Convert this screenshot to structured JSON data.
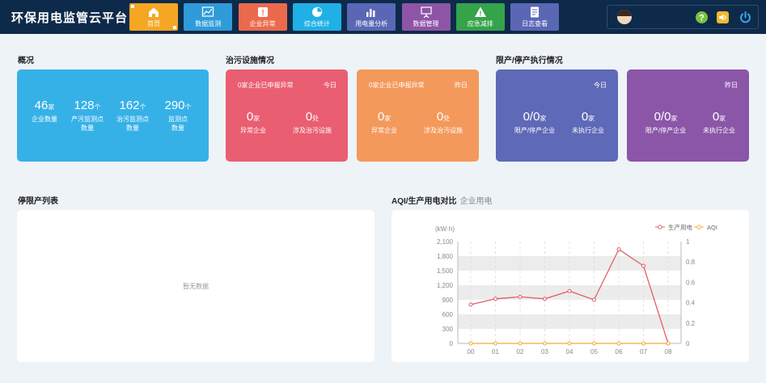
{
  "header": {
    "title": "环保用电监管云平台",
    "nav": [
      {
        "label": "首页",
        "icon": "home-icon",
        "color": "#f5a623"
      },
      {
        "label": "数据监测",
        "icon": "chart-monitor-icon",
        "color": "#2f9bd8"
      },
      {
        "label": "企业异常",
        "icon": "alert-user-icon",
        "color": "#ec6a4c"
      },
      {
        "label": "综合统计",
        "icon": "pie-chart-icon",
        "color": "#1fb0e6"
      },
      {
        "label": "用电量分析",
        "icon": "bar-chart-icon",
        "color": "#5a67b5"
      },
      {
        "label": "数据管理",
        "icon": "presentation-icon",
        "color": "#8e55a6"
      },
      {
        "label": "应急减排",
        "icon": "warning-icon",
        "color": "#35a34a"
      },
      {
        "label": "日志查看",
        "icon": "document-icon",
        "color": "#5a67b5"
      }
    ]
  },
  "overview": {
    "title": "概况",
    "stats": [
      {
        "value": "46",
        "unit": "家",
        "label1": "企业数量",
        "label2": ""
      },
      {
        "value": "128",
        "unit": "个",
        "label1": "产污监测点",
        "label2": "数量"
      },
      {
        "value": "162",
        "unit": "个",
        "label1": "治污监测点",
        "label2": "数量"
      },
      {
        "value": "290",
        "unit": "个",
        "label1": "监测点",
        "label2": "数量"
      }
    ]
  },
  "facilities": {
    "title": "治污设施情况",
    "today": {
      "header": "0家企业已申报异常",
      "period": "今日",
      "v1": "0",
      "u1": "家",
      "l1": "异常企业",
      "v2": "0",
      "u2": "处",
      "l2": "涉及治污设施"
    },
    "yesterday": {
      "header": "0家企业已申报异常",
      "period": "昨日",
      "v1": "0",
      "u1": "家",
      "l1": "异常企业",
      "v2": "0",
      "u2": "处",
      "l2": "涉及治污设施"
    }
  },
  "execution": {
    "title": "限产/停产执行情况",
    "today": {
      "period": "今日",
      "v1": "0/0",
      "u1": "家",
      "l1": "限产/停产企业",
      "v2": "0",
      "u2": "家",
      "l2": "未执行企业"
    },
    "yesterday": {
      "period": "昨日",
      "v1": "0/0",
      "u1": "家",
      "l1": "限产/停产企业",
      "v2": "0",
      "u2": "家",
      "l2": "未执行企业"
    }
  },
  "stoplist": {
    "title": "停限产列表",
    "empty": "暂无数据"
  },
  "aqi": {
    "title": "AQI/生产用电对比",
    "subtitle": "企业用电"
  },
  "chart_data": {
    "type": "line",
    "ylabel": "(kW·h)",
    "categories": [
      "00",
      "01",
      "02",
      "03",
      "04",
      "05",
      "06",
      "07",
      "08"
    ],
    "series": [
      {
        "name": "生产用电",
        "axis": "left",
        "color": "#e35d6a",
        "values": [
          800,
          920,
          960,
          920,
          1080,
          900,
          1940,
          1600,
          0
        ]
      },
      {
        "name": "AQI",
        "axis": "right",
        "color": "#f2a93b",
        "values": [
          0,
          0,
          0,
          0,
          0,
          0,
          0,
          0,
          0
        ]
      }
    ],
    "yticks": [
      "0",
      "300",
      "600",
      "900",
      "1,200",
      "1,500",
      "1,800",
      "2,100"
    ],
    "ylim": [
      0,
      2100
    ],
    "y2ticks": [
      "0",
      "0.2",
      "0.4",
      "0.6",
      "0.8",
      "1"
    ],
    "y2lim": [
      0,
      1
    ],
    "legend": "top-right"
  }
}
